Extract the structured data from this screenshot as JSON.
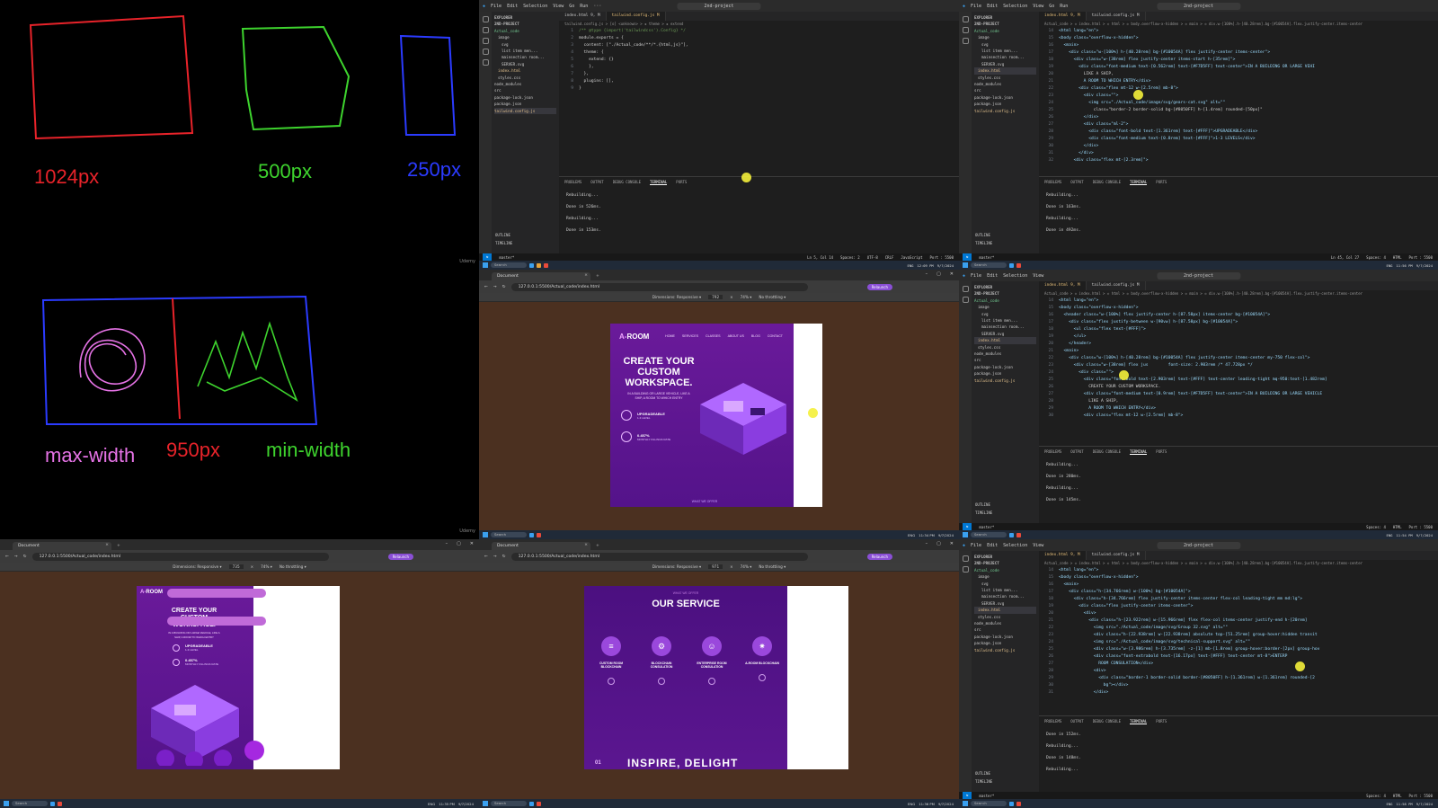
{
  "whiteboard_top": {
    "labels": {
      "red": "1024px",
      "green": "500px",
      "blue": "250px"
    },
    "watermark": "Udemy"
  },
  "whiteboard_bottom": {
    "labels": {
      "pink": "max-width",
      "red": "950px",
      "green": "min-width"
    },
    "watermark": "Udemy"
  },
  "vscode": {
    "menu": [
      "File",
      "Edit",
      "Selection",
      "View",
      "Go",
      "Run",
      "···"
    ],
    "search_title": "2nd-project",
    "explorer": {
      "header": "EXPLORER",
      "project": "2ND-PROJECT",
      "items": [
        "Actual_code",
        "image",
        "svg",
        "list item men...",
        "mainsection room...",
        "SERVER.svg",
        "index.html",
        "styles.css",
        "node_modules",
        "src",
        "package-lock.json",
        "package.json",
        "tailwind.config.js"
      ],
      "outline": "OUTLINE",
      "timeline": "TIMELINE"
    },
    "tabs": [
      "index.html 9, M",
      "tailwind.config.js M"
    ],
    "crumbs_config": "tailwind.config.js > [o] <unknown> > ✚ theme > ✚ extend",
    "crumbs_html": "Actual_code > ◇ index.html > ◇ html > ◇ body.overflow-x-hidden > ◇ main > ◇ div.w-[100%].h-[40.28rem].bg-[#10054A].flex.justify-center.items-center",
    "panel_tabs": [
      "PROBLEMS",
      "OUTPUT",
      "DEBUG CONSOLE",
      "TERMINAL",
      "PORTS"
    ],
    "terminal_1": [
      "Rebuilding...",
      "Done in 526ms.",
      "Rebuilding...",
      "Done in 153ms."
    ],
    "terminal_2": [
      "Rebuilding...",
      "Done in 163ms.",
      "Rebuilding...",
      "Done in 492ms."
    ],
    "terminal_3": [
      "Rebuilding...",
      "Done in 280ms.",
      "Rebuilding...",
      "Done in 145ms."
    ],
    "terminal_4": [
      "Done in 152ms.",
      "Rebuilding...",
      "Done in 148ms.",
      "Rebuilding..."
    ],
    "status": {
      "branch": "master*",
      "position": "Ln 5, Col 14",
      "spaces": "Spaces: 2",
      "encoding": "UTF-8",
      "eol": "CRLF",
      "lang": "JavaScript",
      "port": "Port : 5500"
    },
    "status_html": {
      "position": "Ln 45, Col 27",
      "spaces": "Spaces: 4",
      "lang": "HTML",
      "port": "Port : 5500"
    },
    "config_code": [
      "/** @type {import('tailwindcss').Config} */",
      "module.exports = {",
      "  content: [\"./Actual_code/**/*.{html,js}\"],",
      "  theme: {",
      "    extend: {}",
      "    },",
      "  },",
      "  plugins: [],",
      "}"
    ],
    "html_code_1": [
      "<html lang=\"en\">",
      "<body class=\"overflow-x-hidden\">",
      "  <main>",
      "    <div class=\"w-[100%] h-[40.28rem] bg-[#10054A] flex justify-center items-center\">",
      "      <div class=\"w-[38rem] flex justify-center items-start h-[35rem]\">",
      "        <div class=\"font-medium text-[0.562rem] text-[#F7D5FF] text-center\">IN A BUILDING OR LARGE VEHI",
      "          LIKE A SHIP,",
      "          A ROOM TO WHICH ENTRY</div>",
      "        <div class=\"flex mt-12 w-[2.5rem] mb-8\">",
      "          <div class=\"\">",
      "            <img src=\"./Actual_code/image/svg/gears-cat.svg\" alt=\"\"",
      "              class=\"border-2 border-solid bg-[#8050FF] h-[1.4rem] rounded-[50px]\"",
      "          </div>",
      "          <div class=\"ml-2\">",
      "            <div class=\"font-bold text-[1.361rem] text-[#FFF]\">UPGRADEABLE</div>",
      "            <div class=\"font-medium text-[0.8rem] text-[#FFF]\">1-3 LEVELS</div>",
      "          </div>",
      "        </div>",
      "      <div class=\"flex mt-[2.3rem]\">"
    ],
    "html_code_2": [
      "<html lang=\"en\">",
      "<body class=\"overflow-x-hidden\">",
      "  <header class=\"w-[100%] flex justify-center h-[87.58px] items-center bg-[#10054A]\">",
      "    <div class=\"flex justify-between w-[90vw] h-[87.58px] bg-[#10054A]\">",
      "      <ul class=\"flex text-[#FFF]\">",
      "      </ul>",
      "    </header>",
      "  <main>",
      "    <div class=\"w-[100%] h-[40.28rem] bg-[#10054A] flex justify-center items-center my-750 flex-col\">",
      "      <div class=\"w-[38rem] flex jus        font-size: 2.903rem /* 47.728px */",
      "        <div class=\"\">",
      "          <div class=\"font-bold text-[2.903rem] text-[#FFF] text-center leading-tight mq-950:text-[1.482rem]",
      "            CREATE YOUR CUSTOM WORKSPACE.",
      "          <div class=\"font-medium text-[0.9rem] text-[#F7D5FF] text-center\">IN A BUILDING OR LARGE VEHICLE",
      "            LIKE A SHIP,",
      "            A ROOM TO WHICH ENTRY</div>",
      "          <div class=\"flex mt-12 w-[2.5rem] mb-8\">"
    ],
    "html_code_3": [
      "<html lang=\"en\">",
      "<body class=\"overflow-x-hidden\">",
      "  <main>",
      "    <div class=\"h-[34.766rem] w-[100%] bg-[#10054A]\">",
      "      <div class=\"h-[34.766rem] flex justify-center items-center flex-col leading-tight mm md:lg\">",
      "        <div class=\"flex justify-center items-center\">",
      "          <div>",
      "            <div class=\"h-[23.922rem] w-[15.966rem] flex flex-col items-center justify-end h-[20rem]",
      "              <img src=\"./Actual_code/image/svg/Group 32.svg\" alt=\"\"",
      "              <div class=\"h-[22.938rem] w-[22.938rem] absolute top-[51.25rem] group-hover:hidden transit",
      "              <img src=\"./Actual_code/image/svg/technical-support.svg\" alt=\"\"",
      "              <div class=\"w-[3.986rem] h-[3.735rem] -z-[1] mb-[1.8rem] group-hover:border-[2px] group-hov",
      "              <div class=\"font-extrabold text-[16.17px] text-[#FFF] text-center mt-8\">ENTERP",
      "                ROOM CONSULATION</div>",
      "              <div>",
      "                <div class=\"border-1 border-solid border-[#8050FF] h-[1.361rem] w-[1.361rem] rounded-[2",
      "                  bg\"></div>",
      "              </div>"
    ]
  },
  "taskbar": {
    "search": "Search",
    "lang": "ENG",
    "times": [
      {
        "time": "12:09 PM",
        "date": "9/7/2024"
      },
      {
        "time": "11:56 PM",
        "date": "9/7/2024"
      },
      {
        "time": "11:34 PM",
        "date": "9/7/2024"
      },
      {
        "time": "11:54 PM",
        "date": "9/7/2024"
      },
      {
        "time": "11:35 PM",
        "date": "9/7/2024"
      },
      {
        "time": "11:36 PM",
        "date": "9/7/2024"
      },
      {
        "time": "11:58 PM",
        "date": "9/7/2024"
      }
    ]
  },
  "browser": {
    "tab_title": "Document",
    "url": "127.0.0.1:5500/Actual_code/index.html",
    "relaunch": "Relaunch",
    "devtools": {
      "mode": "Dimensions: Responsive ▾",
      "width_a": "792",
      "width_b": "735",
      "width_c": "971",
      "height": "×",
      "zoom": "74% ▾",
      "throttle": "No throttling ▾"
    }
  },
  "site": {
    "logo_a": "A-",
    "logo_b": "ROOM",
    "nav": [
      "HOME",
      "SERVICES",
      "CLASSES",
      "ABOUT US",
      "BLOG",
      "CONTACT"
    ],
    "hero_title": [
      "CREATE YOUR",
      "CUSTOM",
      "WORKSPACE."
    ],
    "hero_sub": [
      "IN A BUILDING OR LARGE VEHICLE, LIKE A",
      "SHIP, A ROOM TO WHICH ENTRY"
    ],
    "feature_1": {
      "title": "UPGRADEABLE",
      "sub": "1-3 LEVEL"
    },
    "feature_2": {
      "title": "0.457%",
      "sub": "MONTHLY FILLINGS RATE"
    },
    "bottom_hint": "WHAT WE OFFER",
    "service_kicker": "WHAT WE OFFER",
    "service_title": "OUR SERVICE",
    "services": [
      "CUSTOM ROOM BLOCKCHAIN",
      "BLOCKCHAIN CONSULATION",
      "ENTERPRISE ROOM CONSULATION",
      "A-ROOM BLOCKCHAIN"
    ],
    "number": "01",
    "inspire": "INSPIRE, DELIGHT"
  }
}
